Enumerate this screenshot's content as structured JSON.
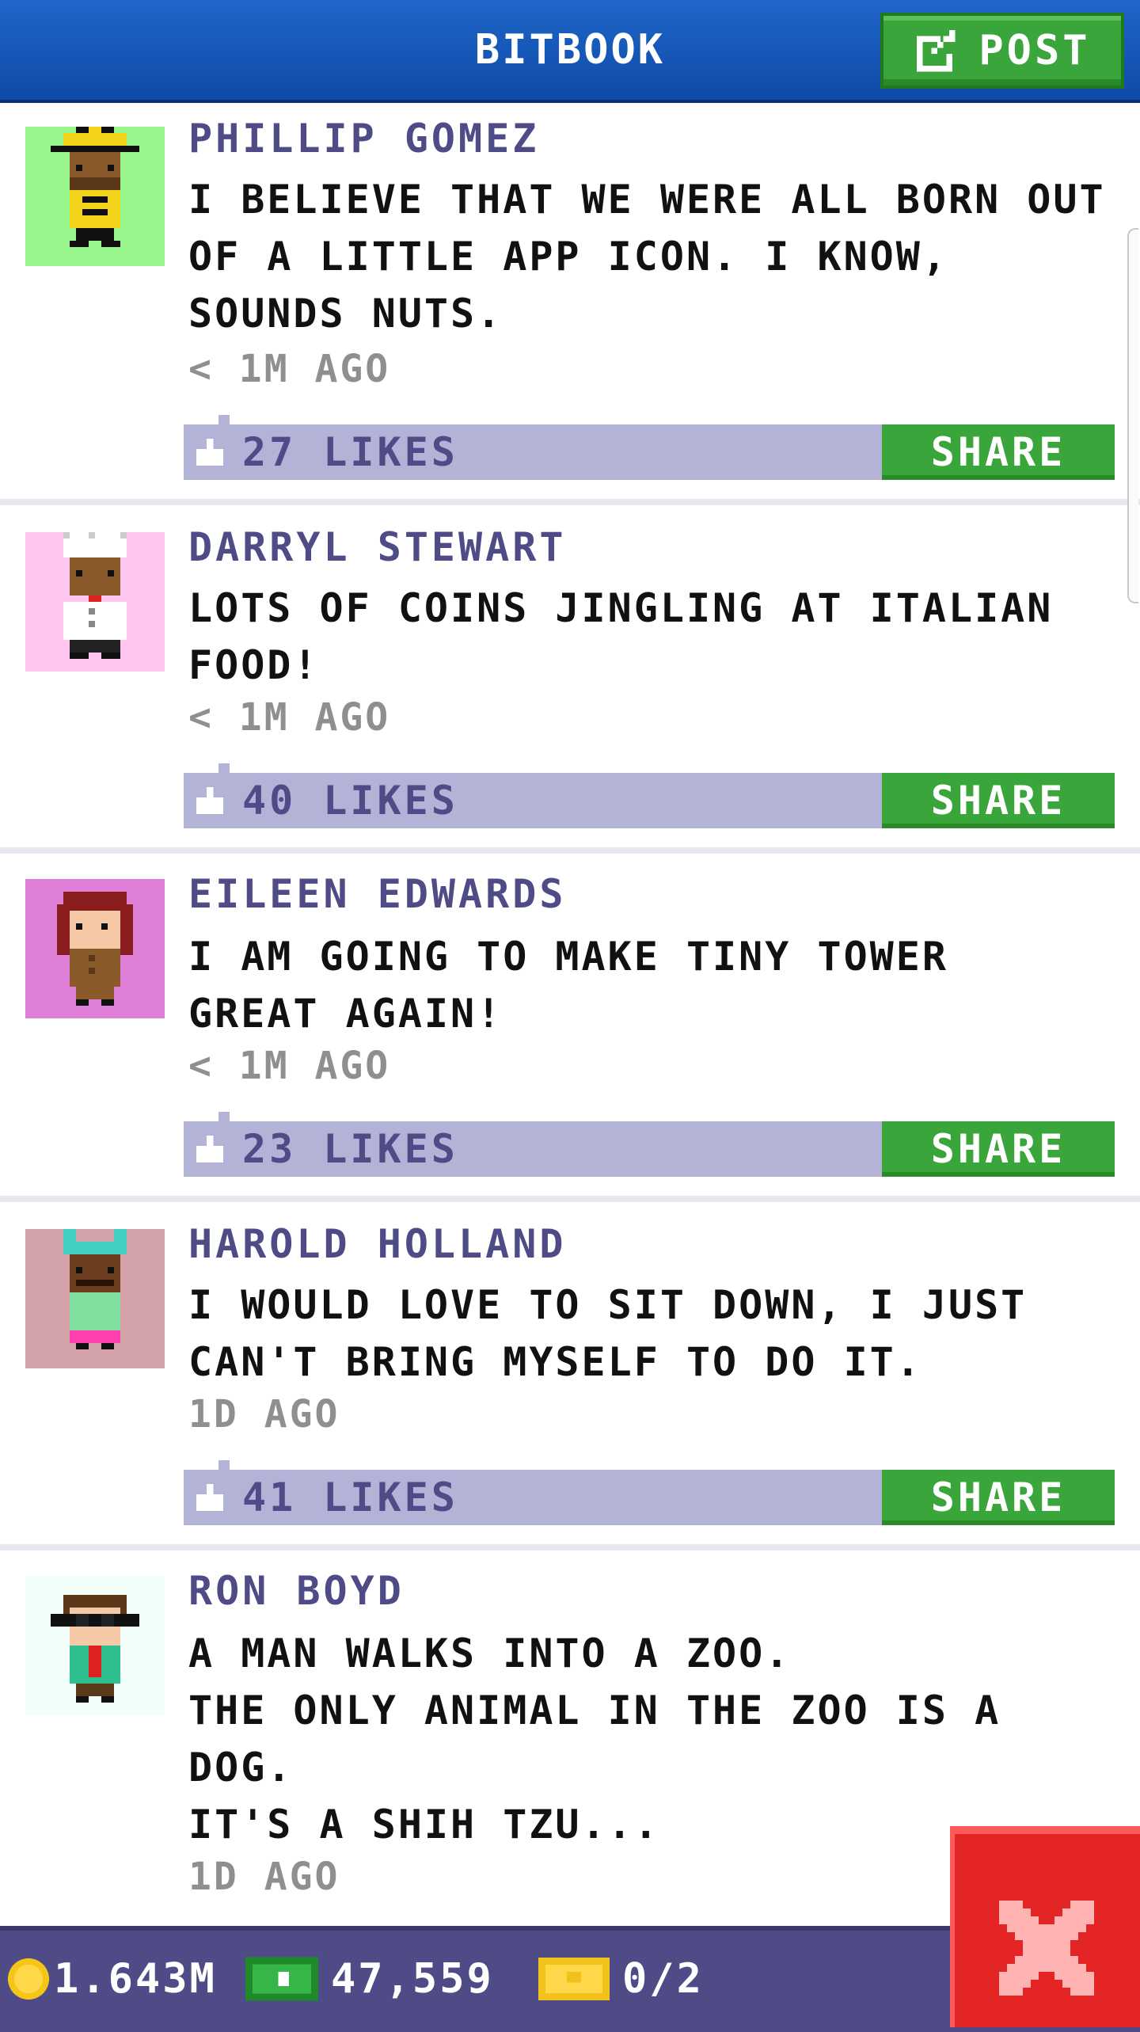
{
  "header": {
    "title": "BITBOOK",
    "post_label": "POST"
  },
  "posts": [
    {
      "author": "PHILLIP GOMEZ",
      "message": "I BELIEVE THAT WE WERE ALL BORN OUT\nOF A LITTLE APP ICON. I KNOW,\nSOUNDS NUTS.",
      "time": "< 1M AGO",
      "likes": "27 LIKES",
      "share_label": "SHARE",
      "avatar_bg": "#98f58c"
    },
    {
      "author": "DARRYL STEWART",
      "message": "LOTS OF COINS JINGLING AT ITALIAN\nFOOD!",
      "time": "< 1M AGO",
      "likes": "40 LIKES",
      "share_label": "SHARE",
      "avatar_bg": "#ffc6f0"
    },
    {
      "author": "EILEEN EDWARDS",
      "message": "I AM GOING TO MAKE TINY TOWER\nGREAT AGAIN!",
      "time": "< 1M AGO",
      "likes": "23 LIKES",
      "share_label": "SHARE",
      "avatar_bg": "#e07fd8"
    },
    {
      "author": "HAROLD HOLLAND",
      "message": "I WOULD LOVE TO SIT DOWN, I JUST\nCAN'T BRING MYSELF TO DO IT.",
      "time": "1D AGO",
      "likes": "41 LIKES",
      "share_label": "SHARE",
      "avatar_bg": "#d2a2a8"
    },
    {
      "author": "RON BOYD",
      "message": "A MAN WALKS INTO A ZOO.\nTHE ONLY ANIMAL IN THE ZOO IS A\nDOG.\nIT'S A SHIH TZU...",
      "time": "1D AGO",
      "avatar_bg": "#f2fff8"
    }
  ],
  "bottom_bar": {
    "coins": "1.643M",
    "bux": "47,559",
    "tickets": "0/2"
  },
  "icons": {
    "post": "edit-icon",
    "like": "thumbs-up-icon",
    "coin": "coin-icon",
    "bux": "bux-icon",
    "ticket": "ticket-icon",
    "close": "close-icon"
  },
  "colors": {
    "header": "#1a5fc0",
    "accent_green": "#3aa53a",
    "author": "#4f4b86",
    "likes_bar": "#b3b3d7",
    "close": "#e32525"
  }
}
